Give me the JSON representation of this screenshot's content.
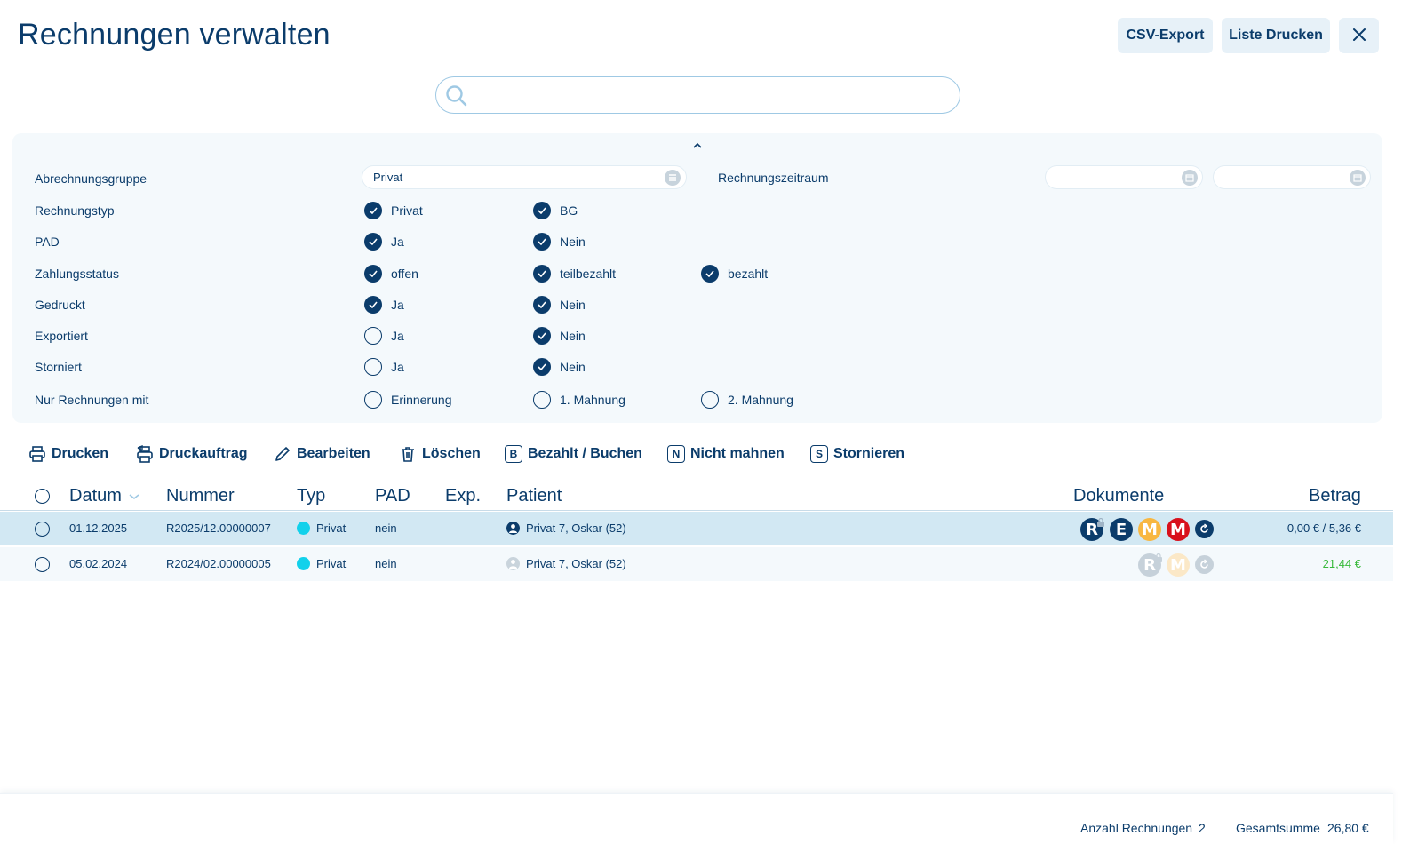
{
  "page": {
    "title": "Rechnungen verwalten"
  },
  "header": {
    "csv_export": "CSV-Export",
    "print_list": "Liste Drucken",
    "close_icon": "close-icon"
  },
  "search": {
    "value": "",
    "placeholder": ""
  },
  "filters": {
    "billing_group": {
      "label": "Abrechnungsgruppe",
      "value": "Privat"
    },
    "period": {
      "label": "Rechnungszeitraum",
      "from": "",
      "to": ""
    },
    "invoice_type": {
      "label": "Rechnungstyp",
      "options": [
        {
          "label": "Privat",
          "checked": true
        },
        {
          "label": "BG",
          "checked": true
        }
      ]
    },
    "pad": {
      "label": "PAD",
      "options": [
        {
          "label": "Ja",
          "checked": true
        },
        {
          "label": "Nein",
          "checked": true
        }
      ]
    },
    "payment_status": {
      "label": "Zahlungsstatus",
      "options": [
        {
          "label": "offen",
          "checked": true
        },
        {
          "label": "teilbezahlt",
          "checked": true
        },
        {
          "label": "bezahlt",
          "checked": true
        }
      ]
    },
    "printed": {
      "label": "Gedruckt",
      "options": [
        {
          "label": "Ja",
          "checked": true
        },
        {
          "label": "Nein",
          "checked": true
        }
      ]
    },
    "exported": {
      "label": "Exportiert",
      "options": [
        {
          "label": "Ja",
          "checked": false
        },
        {
          "label": "Nein",
          "checked": true
        }
      ]
    },
    "cancelled": {
      "label": "Storniert",
      "options": [
        {
          "label": "Ja",
          "checked": false
        },
        {
          "label": "Nein",
          "checked": true
        }
      ]
    },
    "only_with": {
      "label": "Nur Rechnungen mit",
      "options": [
        {
          "label": "Erinnerung",
          "checked": false
        },
        {
          "label": "1. Mahnung",
          "checked": false
        },
        {
          "label": "2. Mahnung",
          "checked": false
        }
      ]
    }
  },
  "toolbar": {
    "print": "Drucken",
    "print_job": "Druckauftrag",
    "edit": "Bearbeiten",
    "delete": "Löschen",
    "paid_book": "Bezahlt / Buchen",
    "paid_letter": "B",
    "no_dunning": "Nicht mahnen",
    "no_dunning_letter": "N",
    "cancel": "Stornieren",
    "cancel_letter": "S"
  },
  "table": {
    "columns": {
      "date": "Datum",
      "number": "Nummer",
      "type": "Typ",
      "pad": "PAD",
      "exp": "Exp.",
      "patient": "Patient",
      "documents": "Dokumente",
      "amount": "Betrag"
    },
    "rows": [
      {
        "date": "01.12.2025",
        "number": "R2025/12.00000007",
        "type": "Privat",
        "pad": "nein",
        "exp": "",
        "patient": "Privat 7, Oskar (52)",
        "documents": [
          "R",
          "E",
          "M",
          "M"
        ],
        "amount": "0,00 € / 5,36 €",
        "selected": true
      },
      {
        "date": "05.02.2024",
        "number": "R2024/02.00000005",
        "type": "Privat",
        "pad": "nein",
        "exp": "",
        "patient": "Privat 7, Oskar (52)",
        "documents": [
          "R",
          "M"
        ],
        "amount": "21,44 €",
        "selected": false
      }
    ]
  },
  "footer": {
    "count_label": "Anzahl Rechnungen",
    "count_value": "2",
    "sum_label": "Gesamtsumme",
    "sum_value": "26,80 €"
  },
  "colors": {
    "primary": "#0b3c6b",
    "accent_type": "#12d1eb",
    "doc_m_orange": "#f8b741",
    "doc_m_red": "#d8101c",
    "amount_paid": "#37b93a"
  }
}
